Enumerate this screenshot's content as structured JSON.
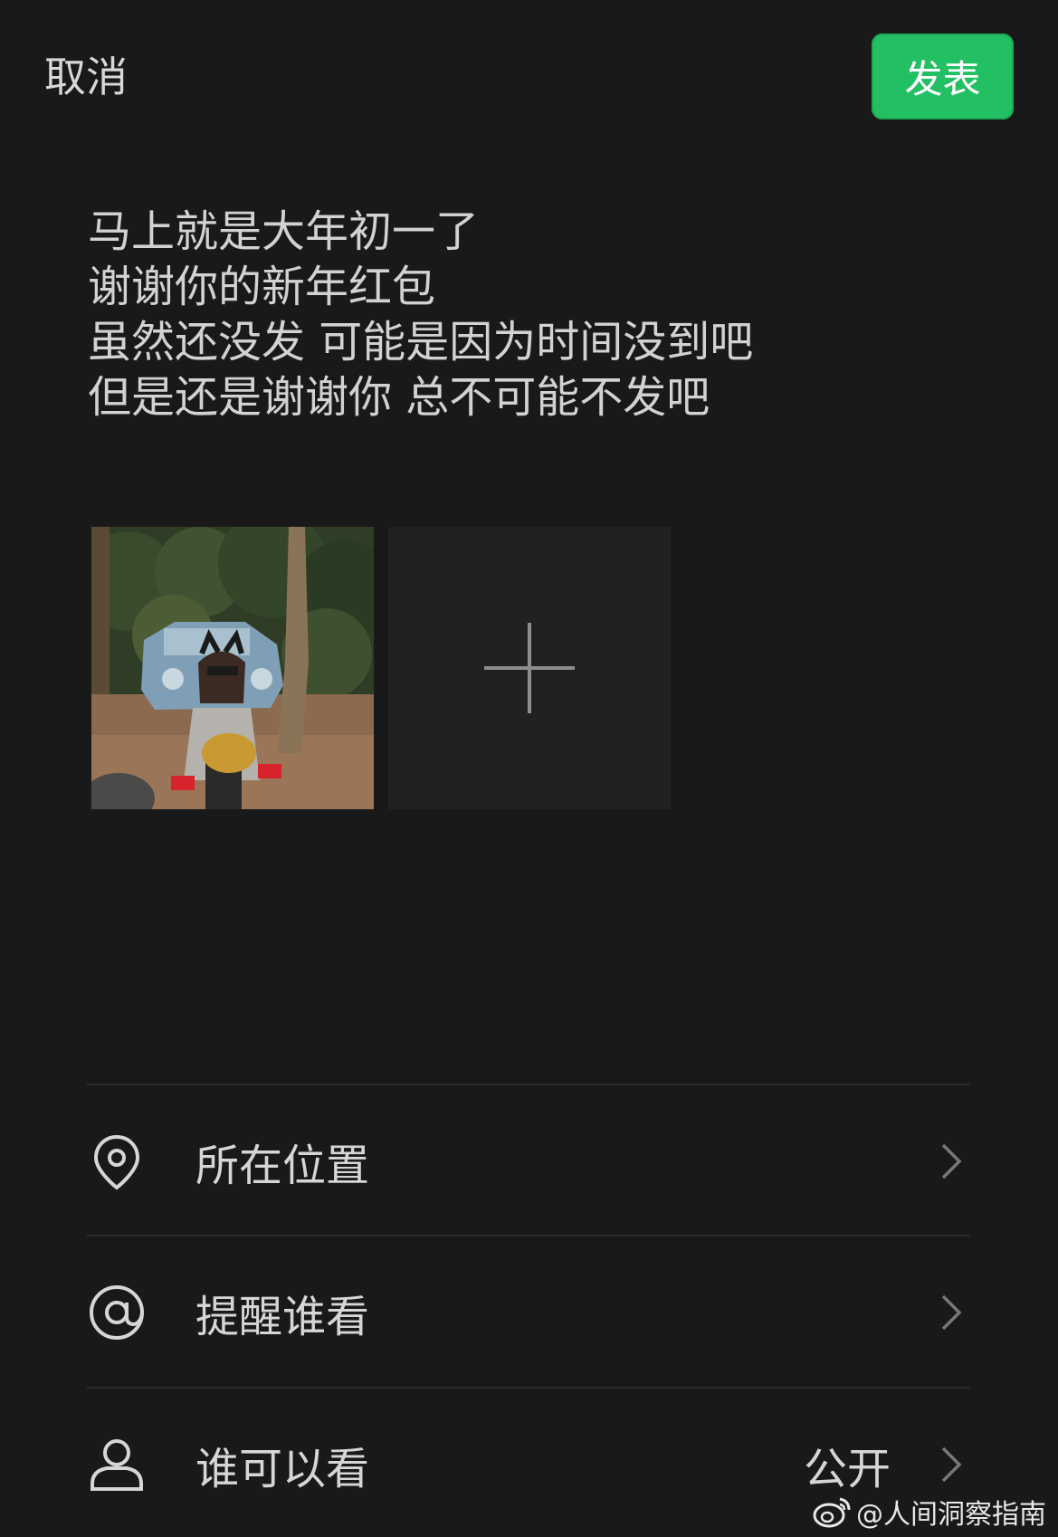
{
  "header": {
    "cancel_label": "取消",
    "publish_label": "发表",
    "publish_color": "#23c063"
  },
  "post": {
    "lines": [
      "马上就是大年初一了",
      "谢谢你的新年红包",
      "虽然还没发 可能是因为时间没到吧",
      "但是还是谢谢你 总不可能不发吧"
    ]
  },
  "media": {
    "photo_icon": "photo-thumbnail",
    "add_icon": "plus-icon"
  },
  "options": [
    {
      "icon": "location-pin-icon",
      "label": "所在位置",
      "value": ""
    },
    {
      "icon": "at-sign-icon",
      "label": "提醒谁看",
      "value": ""
    },
    {
      "icon": "person-icon",
      "label": "谁可以看",
      "value": "公开"
    }
  ],
  "watermark": {
    "text": "@人间洞察指南",
    "icon": "weibo-logo"
  }
}
